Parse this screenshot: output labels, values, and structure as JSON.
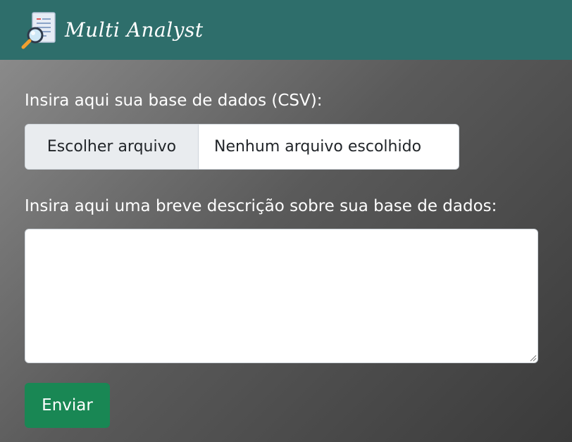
{
  "navbar": {
    "brand": "Multi Analyst",
    "logo_icon": "document-magnifier-icon",
    "background_color": "#2e6e6b"
  },
  "form": {
    "file_label": "Insira aqui sua base de dados (CSV):",
    "file_button_label": "Escolher arquivo",
    "file_status": "Nenhum arquivo escolhido",
    "description_label": "Insira aqui uma breve descrição sobre sua base de dados:",
    "description_value": "",
    "submit_label": "Enviar",
    "submit_color": "#198754"
  }
}
